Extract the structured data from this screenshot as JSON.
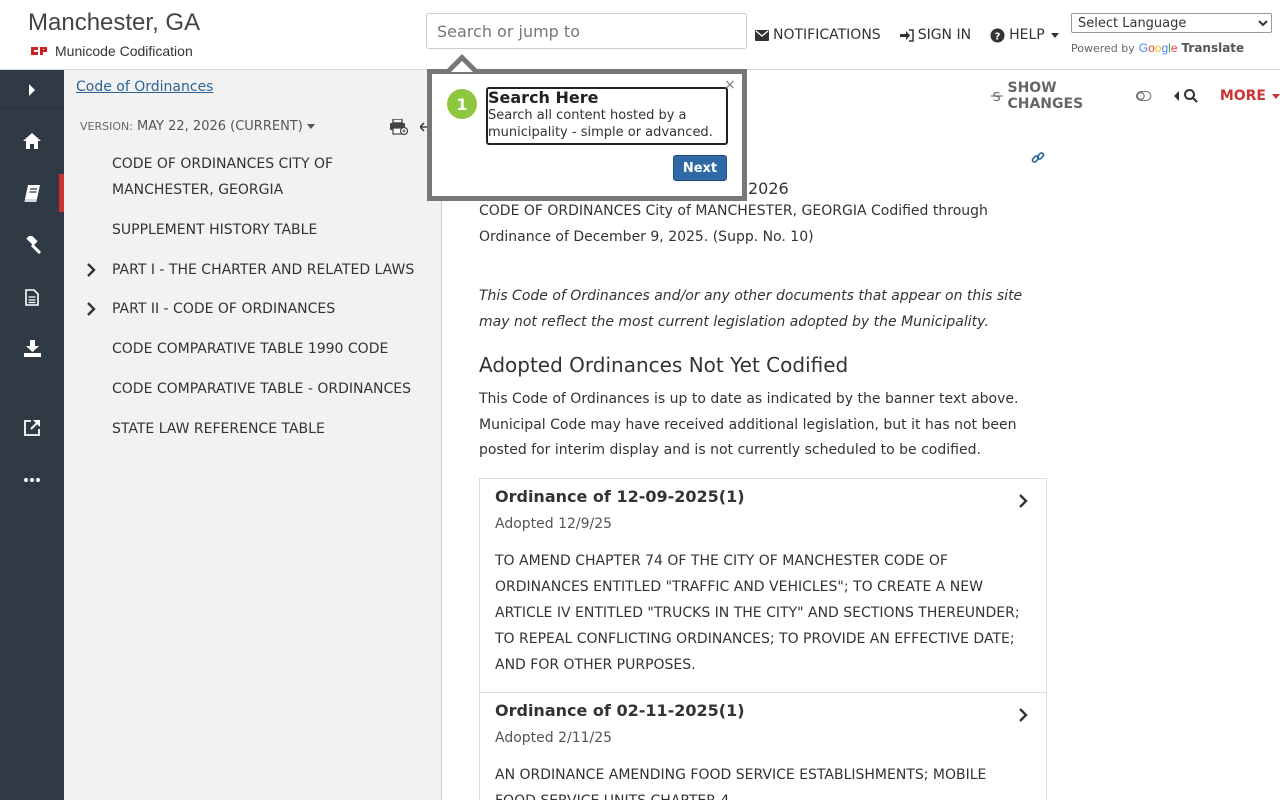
{
  "header": {
    "title": "Manchester, GA",
    "subtitle": "Municode Codification",
    "search_placeholder": "Search or jump to",
    "notifications": "NOTIFICATIONS",
    "sign_in": "SIGN IN",
    "help": "HELP",
    "language_select": "Select Language",
    "powered_by": "Powered by",
    "google": "Google",
    "translate": "Translate"
  },
  "rail": {
    "items": [
      "chevron-right-icon",
      "home-icon",
      "book-icon",
      "gavel-icon",
      "document-icon",
      "download-icon",
      "external-link-icon",
      "ellipsis-icon"
    ]
  },
  "toc": {
    "breadcrumb": "Code of Ordinances",
    "version_label": "VERSION:",
    "version_value": "MAY 22, 2026 (CURRENT)",
    "items": [
      {
        "label": "CODE OF ORDINANCES CITY OF MANCHESTER, GEORGIA",
        "expandable": false
      },
      {
        "label": "SUPPLEMENT HISTORY TABLE",
        "expandable": false
      },
      {
        "label": "PART I - THE CHARTER AND RELATED LAWS",
        "expandable": true
      },
      {
        "label": "PART II - CODE OF ORDINANCES",
        "expandable": true
      },
      {
        "label": "CODE COMPARATIVE TABLE 1990 CODE",
        "expandable": false
      },
      {
        "label": "CODE COMPARATIVE TABLE - ORDINANCES",
        "expandable": false
      },
      {
        "label": "STATE LAW REFERENCE TABLE",
        "expandable": false
      }
    ]
  },
  "toolbar": {
    "show_changes": "SHOW CHANGES",
    "more": "MORE"
  },
  "content": {
    "partial_date": "2026",
    "codified_text": "CODE OF ORDINANCES City of MANCHESTER, GEORGIA Codified through Ordinance of December 9, 2025. (Supp. No. 10)",
    "disclaimer": "This Code of Ordinances and/or any other documents that appear on this site may not reflect the most current legislation adopted by the Municipality.",
    "adopted_heading": "Adopted Ordinances Not Yet Codified",
    "adopted_intro": "This Code of Ordinances is up to date as indicated by the banner text above. Municipal Code may have received additional legislation, but it has not been posted for interim display and is not currently scheduled to be codified.",
    "ordinances": [
      {
        "title": "Ordinance of 12-09-2025(1)",
        "adopted": "Adopted 12/9/25",
        "description": "TO AMEND CHAPTER 74 OF THE CITY OF MANCHESTER CODE OF ORDINANCES ENTITLED \"TRAFFIC AND VEHICLES\"; TO CREATE A NEW ARTICLE IV ENTITLED \"TRUCKS IN THE CITY\" AND SECTIONS THEREUNDER; TO REPEAL CONFLICTING ORDINANCES; TO PROVIDE AN EFFECTIVE DATE; AND FOR OTHER PURPOSES."
      },
      {
        "title": "Ordinance of 02-11-2025(1)",
        "adopted": "Adopted 2/11/25",
        "description": "AN ORDINANCE AMENDING FOOD SERVICE ESTABLISHMENTS; MOBILE FOOD SERVICE UNITS CHAPTER 4"
      }
    ]
  },
  "tour": {
    "step": "1",
    "title": "Search Here",
    "text": "Search all content hosted by a municipality - simple or advanced.",
    "close": "×",
    "next": "Next"
  },
  "colors": {
    "rail_bg": "#2f3a45",
    "accent_red": "#cc3333",
    "link_blue": "#2a6496",
    "tour_badge": "#8dc63f",
    "next_button": "#2f6aa6"
  }
}
